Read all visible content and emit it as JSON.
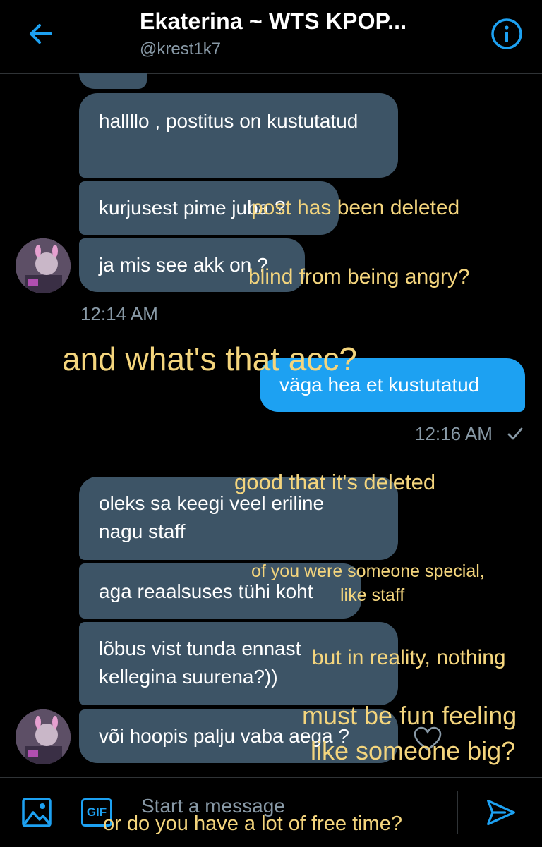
{
  "header": {
    "title": "Ekaterina ~ WTS KPOP...",
    "handle": "@krest1k7"
  },
  "messages": {
    "in1": "hallllo , postitus on kustutatud",
    "in2": "kurjusest pime juba ?",
    "in3": "ja mis see akk on ?",
    "time1": "12:14 AM",
    "out1": "väga hea et kustutatud",
    "time2": "12:16 AM",
    "in4": "oleks sa keegi veel eriline nagu staff",
    "in5": "aga reaalsuses tühi koht",
    "in6": "lõbus vist tunda ennast kellegina suurena?))",
    "in7": "või hoopis palju vaba aega ?"
  },
  "translations": {
    "t1": "post has been deleted",
    "t2": "blind from being angry?",
    "t3": "and what's that acc?",
    "t4": "good that it's deleted",
    "t5a": "of you were someone special,",
    "t5b": "like staff",
    "t6": "but in reality, nothing",
    "t7a": "must be fun feeling",
    "t7b": "like someone big?",
    "t8": "or do you have a lot of free time?"
  },
  "composer": {
    "placeholder": "Start a message",
    "gif_label": "GIF"
  },
  "colors": {
    "accent": "#1da1f2",
    "bubble_in": "#3d5466",
    "translation_text": "#f4d57d"
  },
  "icons": [
    "back-arrow-icon",
    "info-icon",
    "image-icon",
    "gif-icon",
    "heart-icon",
    "send-icon",
    "checkmark-icon"
  ]
}
